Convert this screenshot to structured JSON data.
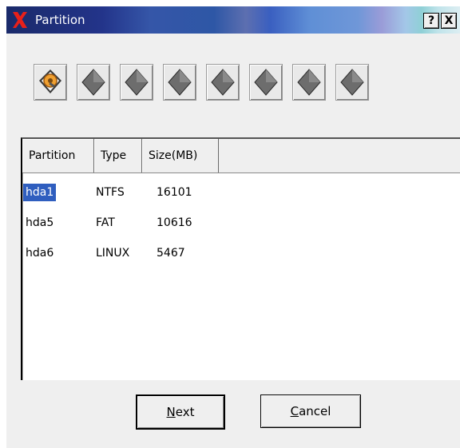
{
  "window": {
    "title": "Partition",
    "help_label": "?",
    "close_label": "X"
  },
  "toolbar": {
    "items": [
      {
        "icon": "harddisk-icon"
      },
      {
        "icon": "disk-icon"
      },
      {
        "icon": "disk-icon"
      },
      {
        "icon": "disk-icon"
      },
      {
        "icon": "disk-icon"
      },
      {
        "icon": "disk-icon"
      },
      {
        "icon": "disk-icon"
      },
      {
        "icon": "disk-icon"
      }
    ]
  },
  "table": {
    "columns": [
      "Partition",
      "Type",
      "Size(MB)"
    ],
    "rows": [
      {
        "partition": "hda1",
        "type": "NTFS",
        "size": "16101",
        "selected": true
      },
      {
        "partition": "hda5",
        "type": "FAT",
        "size": "10616",
        "selected": false
      },
      {
        "partition": "hda6",
        "type": "LINUX",
        "size": "5467",
        "selected": false
      }
    ]
  },
  "buttons": {
    "next_mnemonic": "N",
    "next_rest": "ext",
    "cancel_mnemonic": "C",
    "cancel_rest": "ancel"
  },
  "colors": {
    "selection": "#2f5ebf",
    "window_bg": "#efefef"
  }
}
